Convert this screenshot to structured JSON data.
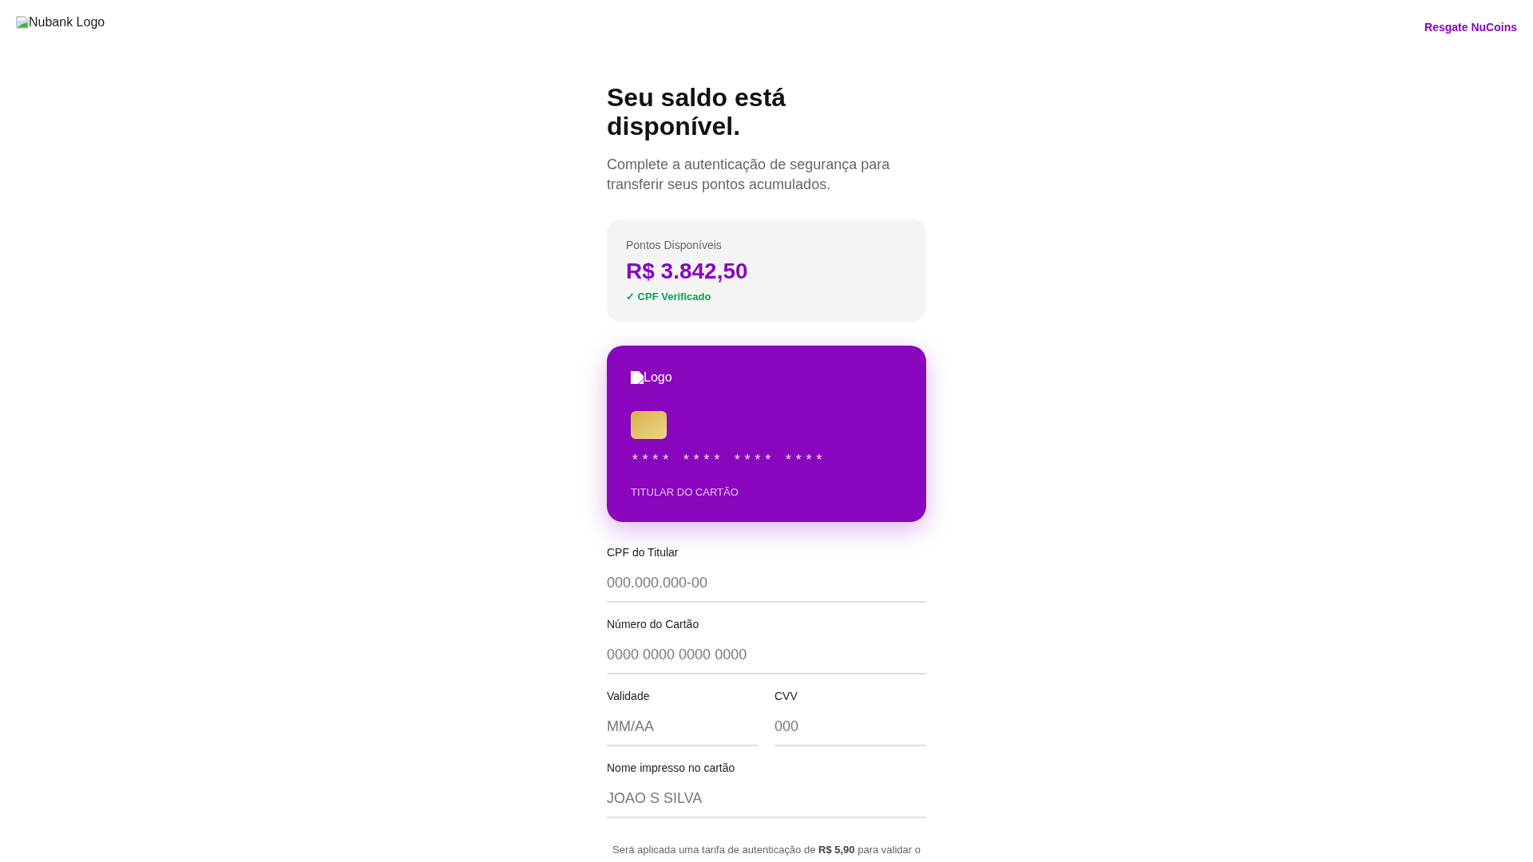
{
  "header": {
    "logo_alt": "Nubank Logo",
    "link": "Resgate NuCoins"
  },
  "hero": {
    "title": "Seu saldo está disponível.",
    "subtitle": "Complete a autenticação de segurança para transferir seus pontos acumulados."
  },
  "balance_card": {
    "label": "Pontos Disponíveis",
    "amount": "R$ 3.842,50",
    "status": "✓ CPF Verificado"
  },
  "credit_card": {
    "logo_alt": "Logo",
    "number": "**** **** **** ****",
    "holder": "TITULAR DO CARTÃO"
  },
  "form": {
    "rows": [
      [
        {
          "label": "CPF do Titular",
          "placeholder": "000.000.000-00"
        }
      ],
      [
        {
          "label": "Número do Cartão",
          "placeholder": "0000 0000 0000 0000"
        }
      ],
      [
        {
          "label": "Validade",
          "placeholder": "MM/AA"
        },
        {
          "label": "CVV",
          "placeholder": "000"
        }
      ],
      [
        {
          "label": "Nome impresso no cartão",
          "placeholder": "JOAO S SILVA"
        }
      ]
    ]
  },
  "notice": "Será aplicada uma tarifa de autenticação de **R$ 5,90** para validar o"
}
